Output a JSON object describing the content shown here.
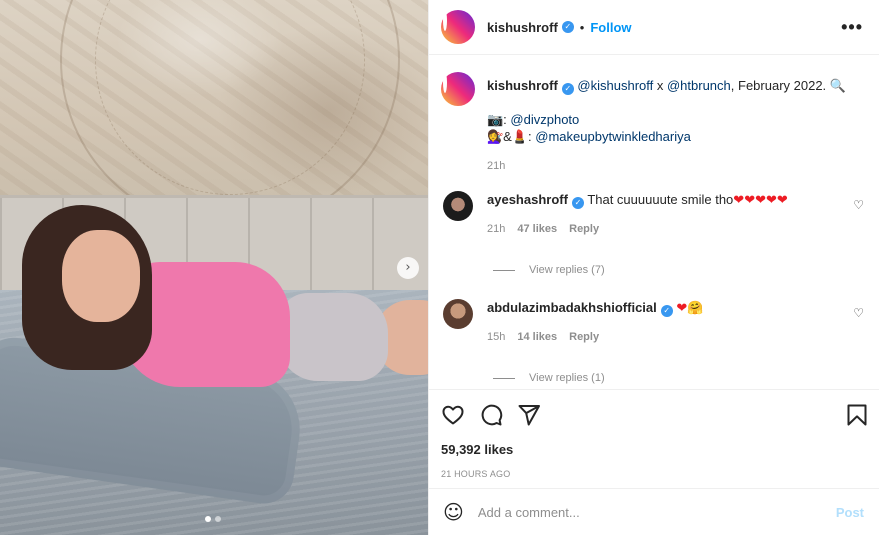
{
  "post": {
    "username": "kishushroff",
    "follow_label": "Follow",
    "separator": "•",
    "more_label": "•••"
  },
  "caption": {
    "username": "kishushroff",
    "mention1": "@kishushroff",
    "x_text": " x ",
    "mention2": "@htbrunch",
    "rest": ", February 2022. 🔍",
    "line2_prefix": "📷: ",
    "line2_mention": "@divzphoto",
    "line3_prefix": "💇‍♀️&💄: ",
    "line3_mention": "@makeupbytwinkledhariya",
    "time": "21h"
  },
  "comments": [
    {
      "username": "ayeshashroff",
      "text": "That cuuuuuute smile tho",
      "emoji": "❤❤❤❤❤",
      "time": "21h",
      "likes": "47 likes",
      "reply_label": "Reply",
      "view_replies": "View replies (7)"
    },
    {
      "username": "abdulazimbadakhshiofficial",
      "text": "",
      "emoji": "❤🤗",
      "time": "15h",
      "likes": "14 likes",
      "reply_label": "Reply",
      "view_replies": "View replies (1)"
    }
  ],
  "actions": {
    "likes_count": "59,392 likes",
    "time_ago": "21 HOURS AGO"
  },
  "add_comment": {
    "placeholder": "Add a comment...",
    "post_label": "Post"
  },
  "icons": {
    "verified": "verified-badge-icon",
    "like": "heart-icon",
    "comment": "comment-icon",
    "share": "paper-plane-icon",
    "save": "bookmark-icon",
    "emoji": "smile-icon",
    "next": "chevron-right-icon"
  },
  "colors": {
    "accent": "#0095f6",
    "verified": "#3897f0",
    "muted": "#8e8e8e",
    "post_disabled": "#b2dffc"
  },
  "carousel": {
    "slide_count": 2,
    "active_index": 0
  }
}
